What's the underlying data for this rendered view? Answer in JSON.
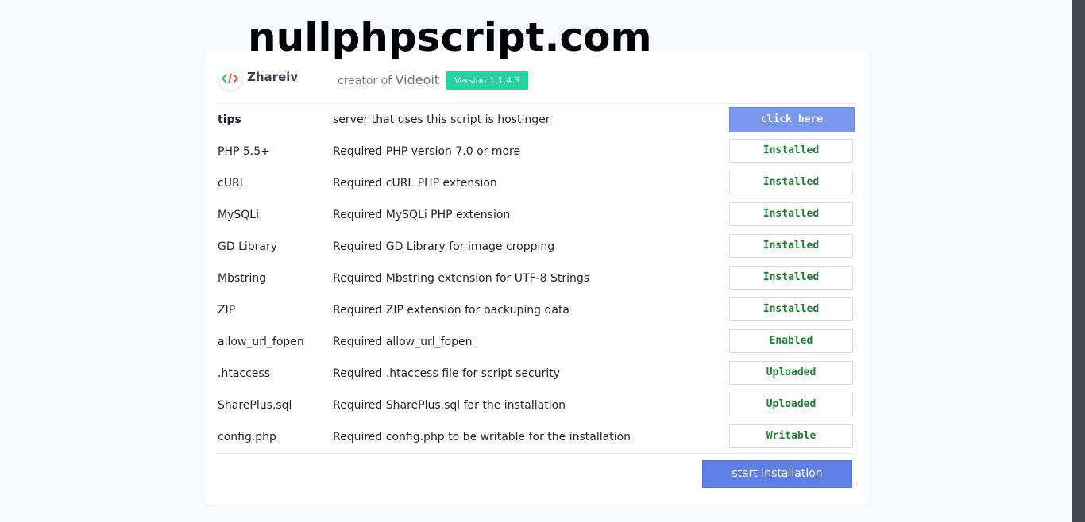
{
  "watermark": "nullphpscript.com",
  "header": {
    "brand": "Zhareiv",
    "creator_prefix": "creator of",
    "product": "Videoit",
    "version": "Version:1.1.4.3"
  },
  "rows": [
    {
      "name": "tips",
      "desc": "server that uses this script is hostinger",
      "status": "click here"
    },
    {
      "name": "PHP 5.5+",
      "desc": "Required PHP version 7.0 or more",
      "status": "Installed"
    },
    {
      "name": "cURL",
      "desc": "Required cURL PHP extension",
      "status": "Installed"
    },
    {
      "name": "MySQLi",
      "desc": "Required MySQLi PHP extension",
      "status": "Installed"
    },
    {
      "name": "GD Library",
      "desc": "Required GD Library for image cropping",
      "status": "Installed"
    },
    {
      "name": "Mbstring",
      "desc": "Required Mbstring extension for UTF-8 Strings",
      "status": "Installed"
    },
    {
      "name": "ZIP",
      "desc": "Required ZIP extension for backuping data",
      "status": "Installed"
    },
    {
      "name": "allow_url_fopen",
      "desc": "Required allow_url_fopen",
      "status": "Enabled"
    },
    {
      "name": ".htaccess",
      "desc": "Required .htaccess file for script security",
      "status": "Uploaded"
    },
    {
      "name": "SharePlus.sql",
      "desc": "Required SharePlus.sql for the installation",
      "status": "Uploaded"
    },
    {
      "name": "config.php",
      "desc": "Required config.php to be writable for the installation",
      "status": "Writable"
    }
  ],
  "start_button": "start installation",
  "colors": {
    "accent": "#5f7ee6",
    "version_badge": "#21d4a0",
    "status_ok": "#1b7f2d"
  }
}
